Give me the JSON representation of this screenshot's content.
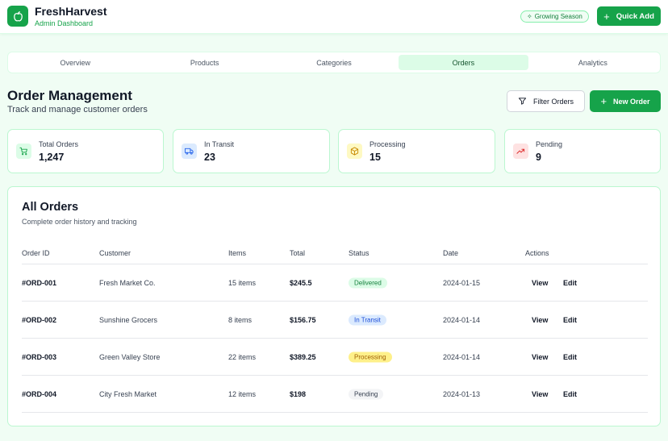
{
  "header": {
    "brand_name": "FreshHarvest",
    "brand_sub": "Admin Dashboard",
    "season_badge": "Growing Season",
    "quick_add": "Quick Add"
  },
  "tabs": [
    {
      "label": "Overview",
      "active": false
    },
    {
      "label": "Products",
      "active": false
    },
    {
      "label": "Categories",
      "active": false
    },
    {
      "label": "Orders",
      "active": true
    },
    {
      "label": "Analytics",
      "active": false
    }
  ],
  "page": {
    "title": "Order Management",
    "subtitle": "Track and manage customer orders",
    "filter_label": "Filter Orders",
    "new_order_label": "New Order"
  },
  "stats": [
    {
      "label": "Total Orders",
      "value": "1,247",
      "icon": "cart-icon",
      "color": "#16a34a",
      "bg": "#dcfce7"
    },
    {
      "label": "In Transit",
      "value": "23",
      "icon": "truck-icon",
      "color": "#2563eb",
      "bg": "#dbeafe"
    },
    {
      "label": "Processing",
      "value": "15",
      "icon": "package-icon",
      "color": "#ca8a04",
      "bg": "#fef9c3"
    },
    {
      "label": "Pending",
      "value": "9",
      "icon": "trending-up-icon",
      "color": "#dc2626",
      "bg": "#fee2e2"
    }
  ],
  "orders": {
    "title": "All Orders",
    "subtitle": "Complete order history and tracking",
    "columns": [
      "Order ID",
      "Customer",
      "Items",
      "Total",
      "Status",
      "Date",
      "Actions"
    ],
    "rows": [
      {
        "id": "#ORD-001",
        "customer": "Fresh Market Co.",
        "items": "15 items",
        "total": "$245.5",
        "status": "Delivered",
        "date": "2024-01-15"
      },
      {
        "id": "#ORD-002",
        "customer": "Sunshine Grocers",
        "items": "8 items",
        "total": "$156.75",
        "status": "In Transit",
        "date": "2024-01-14"
      },
      {
        "id": "#ORD-003",
        "customer": "Green Valley Store",
        "items": "22 items",
        "total": "$389.25",
        "status": "Processing",
        "date": "2024-01-14"
      },
      {
        "id": "#ORD-004",
        "customer": "City Fresh Market",
        "items": "12 items",
        "total": "$198",
        "status": "Pending",
        "date": "2024-01-13"
      }
    ],
    "view_label": "View",
    "edit_label": "Edit"
  },
  "status_colors": {
    "Delivered": {
      "bg": "#dcfce7",
      "fg": "#15803d"
    },
    "In Transit": {
      "bg": "#dbeafe",
      "fg": "#1d4ed8"
    },
    "Processing": {
      "bg": "#fef08a",
      "fg": "#a16207"
    },
    "Pending": {
      "bg": "#f3f4f6",
      "fg": "#374151"
    }
  },
  "colors": {
    "accent": "#16a34a",
    "background": "#f0fdf4"
  }
}
